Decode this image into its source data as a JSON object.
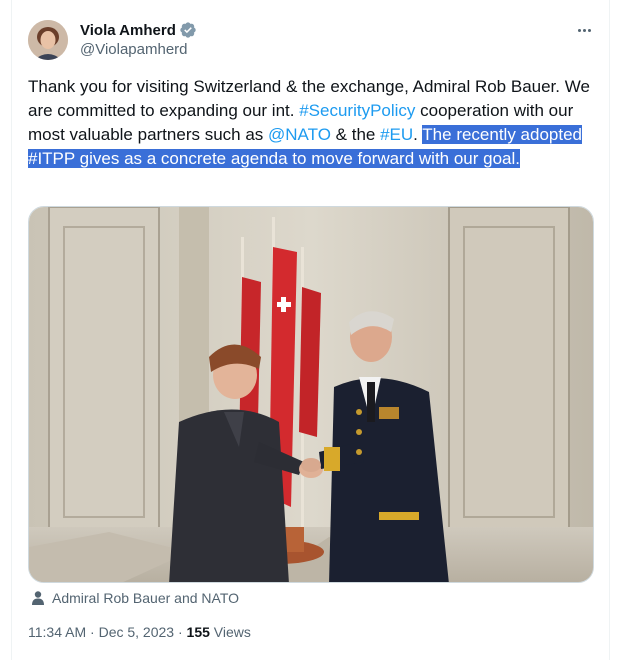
{
  "author": {
    "name": "Viola Amherd",
    "handle": "@Violapamherd",
    "verified_icon": "verified-badge-icon"
  },
  "more_icon": "more-dots-icon",
  "tweet": {
    "segments": [
      {
        "text": "Thank you for visiting Switzerland & the exchange, Admiral Rob Bauer. We are committed to expanding our int. ",
        "style": "plain"
      },
      {
        "text": "#SecurityPolicy",
        "style": "link"
      },
      {
        "text": " cooperation with our most valuable partners such as ",
        "style": "plain"
      },
      {
        "text": "@NATO",
        "style": "link"
      },
      {
        "text": " & the ",
        "style": "plain"
      },
      {
        "text": "#EU",
        "style": "link"
      },
      {
        "text": ". ",
        "style": "plain"
      },
      {
        "text": "The recently adopted #ITPP gives as a concrete agenda to move forward with our goal.",
        "style": "selected"
      }
    ]
  },
  "media": {
    "alt_icon": "photo"
  },
  "caption": {
    "icon": "person-icon",
    "text": "Admiral Rob Bauer and NATO"
  },
  "meta": {
    "time": "11:34 AM",
    "sep1": " · ",
    "date": "Dec 5, 2023",
    "sep2": " · ",
    "views_count": "155",
    "views_label": " Views"
  },
  "colors": {
    "link": "#1d9bf0",
    "selection": "#3a6fd8",
    "muted": "#536471"
  }
}
